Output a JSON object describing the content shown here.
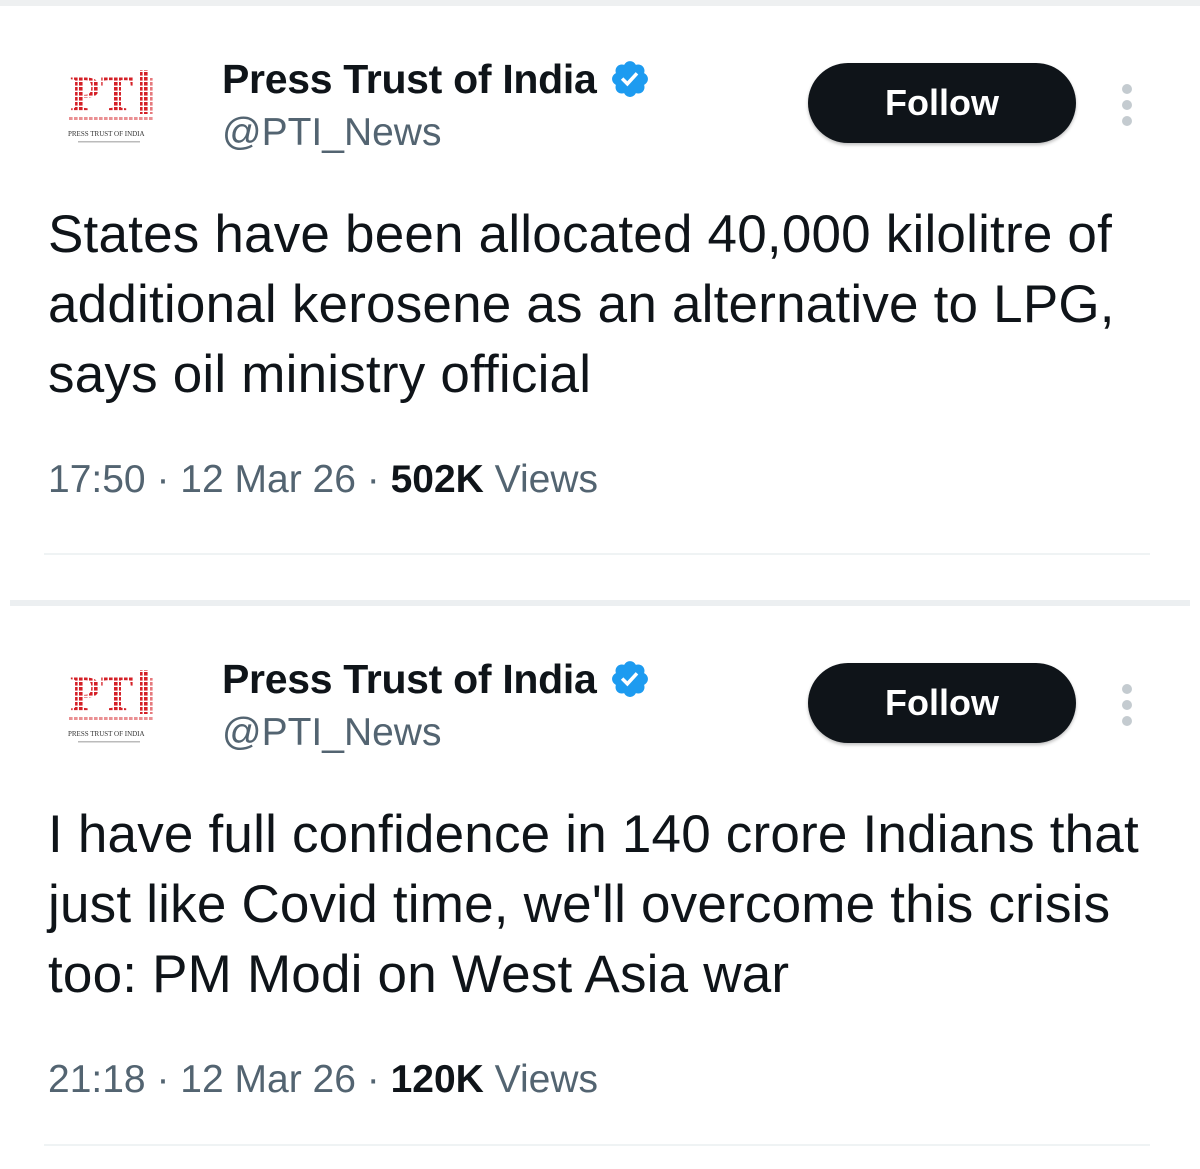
{
  "tweets": [
    {
      "author_name": "Press Trust of India",
      "handle": "@PTI_News",
      "follow_label": "Follow",
      "logo_text": "PTI",
      "logo_caption": "PRESS TRUST OF INDIA",
      "text": "States have been allocated 40,000 kilolitre of additional kerosene as an alternative to LPG, says oil ministry official",
      "time": "17:50",
      "date": "12 Mar 26",
      "views_count": "502K",
      "views_label": "Views",
      "separator": "·"
    },
    {
      "author_name": "Press Trust of India",
      "handle": "@PTI_News",
      "follow_label": "Follow",
      "logo_text": "PTI",
      "logo_caption": "PRESS TRUST OF INDIA",
      "text": "I have full confidence in 140 crore Indians that just like Covid time, we'll overcome this crisis too: PM Modi on West Asia war",
      "time": "21:18",
      "date": "12 Mar 26",
      "views_count": "120K",
      "views_label": "Views",
      "separator": "·"
    }
  ],
  "colors": {
    "verified_blue": "#1d9bf0",
    "follow_bg": "#0f1419",
    "muted_text": "#536471",
    "logo_red": "#d42027"
  },
  "icons": {
    "verified": "verified-badge-icon",
    "more": "more-vertical-icon"
  }
}
